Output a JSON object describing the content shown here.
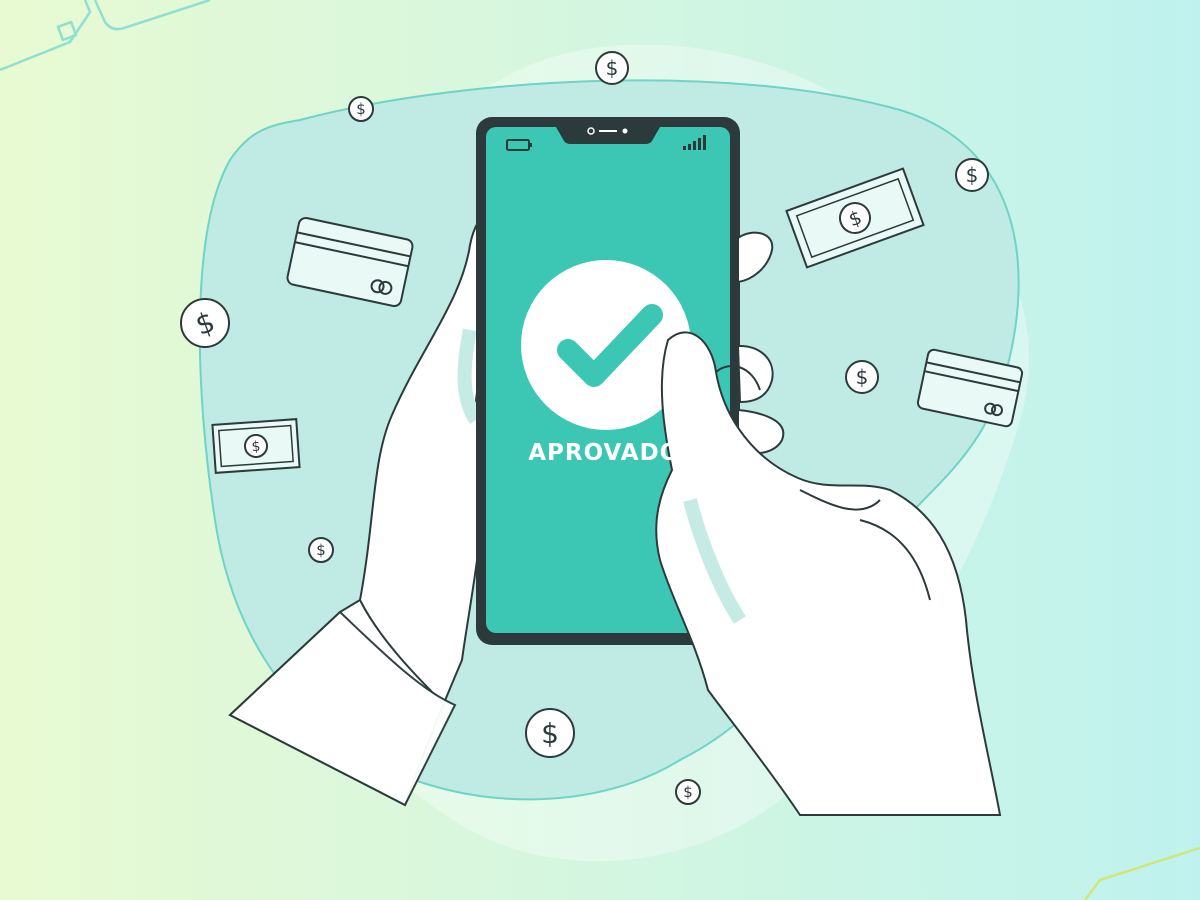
{
  "screen": {
    "status_text": "APROVADO!"
  },
  "icons": {
    "status_icon": "check-icon",
    "coin_icon": "dollar-coin-icon",
    "card_icon": "credit-card-icon",
    "banknote_icon": "banknote-icon",
    "battery_icon": "battery-icon",
    "signal_icon": "signal-bars-icon"
  },
  "colors": {
    "background_left": "#e8fad2",
    "background_right": "#bff2ee",
    "blob": "#bfebe4",
    "screen": "#3cc6b4",
    "phone_frame": "#2d3a3c",
    "line": "#2d3a3c",
    "accent": "#3cc6b4",
    "glove": "#ffffff",
    "glove_shadow": "#c6ebe5"
  }
}
